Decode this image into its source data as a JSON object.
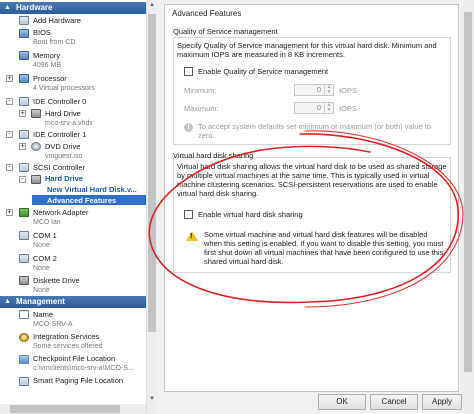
{
  "tree": {
    "hardware_header": "Hardware",
    "management_header": "Management",
    "hardware": [
      {
        "label": "Add Hardware",
        "sub": ""
      },
      {
        "label": "BIOS",
        "sub": "Boot from CD"
      },
      {
        "label": "Memory",
        "sub": "4096 MB"
      },
      {
        "label": "Processor",
        "sub": "4 Virtual processors"
      },
      {
        "label": "IDE Controller 0",
        "sub": ""
      },
      {
        "label": "Hard Drive",
        "sub": "mco-srv-a.vhdx"
      },
      {
        "label": "IDE Controller 1",
        "sub": ""
      },
      {
        "label": "DVD Drive",
        "sub": "vmguest.iso"
      },
      {
        "label": "SCSI Controller",
        "sub": ""
      },
      {
        "label": "Hard Drive",
        "sub": ""
      },
      {
        "label": "New Virtual Hard Disk.v...",
        "sub": ""
      },
      {
        "label": "Advanced Features",
        "sub": ""
      },
      {
        "label": "Network Adapter",
        "sub": "MCO lan"
      },
      {
        "label": "COM 1",
        "sub": "None"
      },
      {
        "label": "COM 2",
        "sub": "None"
      },
      {
        "label": "Diskette Drive",
        "sub": "None"
      }
    ],
    "management": [
      {
        "label": "Name",
        "sub": "MCO-SRV-A"
      },
      {
        "label": "Integration Services",
        "sub": "Some services offered"
      },
      {
        "label": "Checkpoint File Location",
        "sub": "c:\\vmclients\\mco-srv-a\\MCO-S..."
      },
      {
        "label": "Smart Paging File Location",
        "sub": ""
      }
    ]
  },
  "panel": {
    "title": "Advanced Features",
    "qos": {
      "legend": "Quality of Service management",
      "description": "Specify Quality of Service management for this virtual hard disk. Minimum and maximum IOPS are measured in 8 KB increments.",
      "enable_label": "Enable Quality of Service management",
      "minimum_label": "Minimum:",
      "maximum_label": "Maximum:",
      "minimum_value": "0",
      "maximum_value": "0",
      "unit": "IOPS",
      "hint": "To accept system defaults set minimum or maximum (or both) value to zero."
    },
    "sharing": {
      "legend": "Virtual hard disk sharing",
      "description": "Virtual hard disk sharing allows the virtual hard disk to be used as shared storage by multiple virtual machines at the same time. This is typically used in virtual machine clustering scenarios. SCSI-persistent reservations are used to enable virtual hard disk sharing.",
      "enable_label": "Enable virtual hard disk sharing",
      "warning": "Some virtual machine and virtual hard disk features will be disabled when this setting is enabled. If you want to disable this setting, you must first shut down all virtual machines that have been configured to use this shared virtual hard disk."
    }
  },
  "buttons": {
    "ok": "OK",
    "cancel": "Cancel",
    "apply": "Apply"
  },
  "colors": {
    "header_blue": "#2d5c9a",
    "selection_blue": "#2f6fc7",
    "annotation_red": "#e02020",
    "warning_yellow": "#f2c22b"
  }
}
